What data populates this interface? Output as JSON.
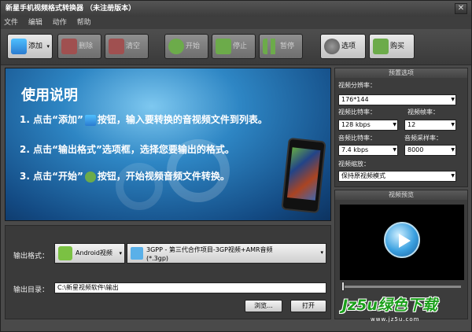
{
  "window": {
    "title": "新星手机视频格式转换器 （未注册版本）",
    "close": "✕"
  },
  "menu": [
    "文件",
    "编辑",
    "动作",
    "帮助"
  ],
  "toolbar": {
    "add": "添加",
    "delete": "删除",
    "clear": "清空",
    "start": "开始",
    "stop": "停止",
    "pause": "暂停",
    "options": "选项",
    "buy": "购买"
  },
  "howto": {
    "title": "使用说明",
    "step1_a": "1. 点击“添加”",
    "step1_b": "按钮，输入要转换的音视频文件到列表。",
    "step2": "2. 点击“输出格式”选项框，选择您要输出的格式。",
    "step3_a": "3. 点击“开始”",
    "step3_b": "按钮，开始视频音频文件转换。"
  },
  "output": {
    "format_label": "输出格式：",
    "device": "Android视频",
    "format_line1": "3GPP -   第三代合作项目-3GP视频+AMR音频",
    "format_line2": "(*.3gp)",
    "dir_label": "输出目录：",
    "dir_value": "C:\\新星视频软件\\输出",
    "browse": "浏览...",
    "open": "打开"
  },
  "preset": {
    "header": "预置选项",
    "resolution_label": "视频分辨率：",
    "resolution": "176*144",
    "vbitrate_label": "视频比特率：",
    "vbitrate": "128 kbps",
    "framerate_label": "视频帧率：",
    "framerate": "12",
    "abitrate_label": "音频比特率：",
    "abitrate": "7.4 kbps",
    "samplerate_label": "音频采样率：",
    "samplerate": "8000",
    "scale_label": "视频缩放：",
    "scale": "保持原视频模式"
  },
  "preview": {
    "header": "视频预览"
  },
  "watermark": {
    "text": "Jz5u绿色下载",
    "url": "www.jz5u.com"
  },
  "colors": {
    "accent_green": "#1aa01a",
    "play_blue": "#3aa0e0"
  }
}
